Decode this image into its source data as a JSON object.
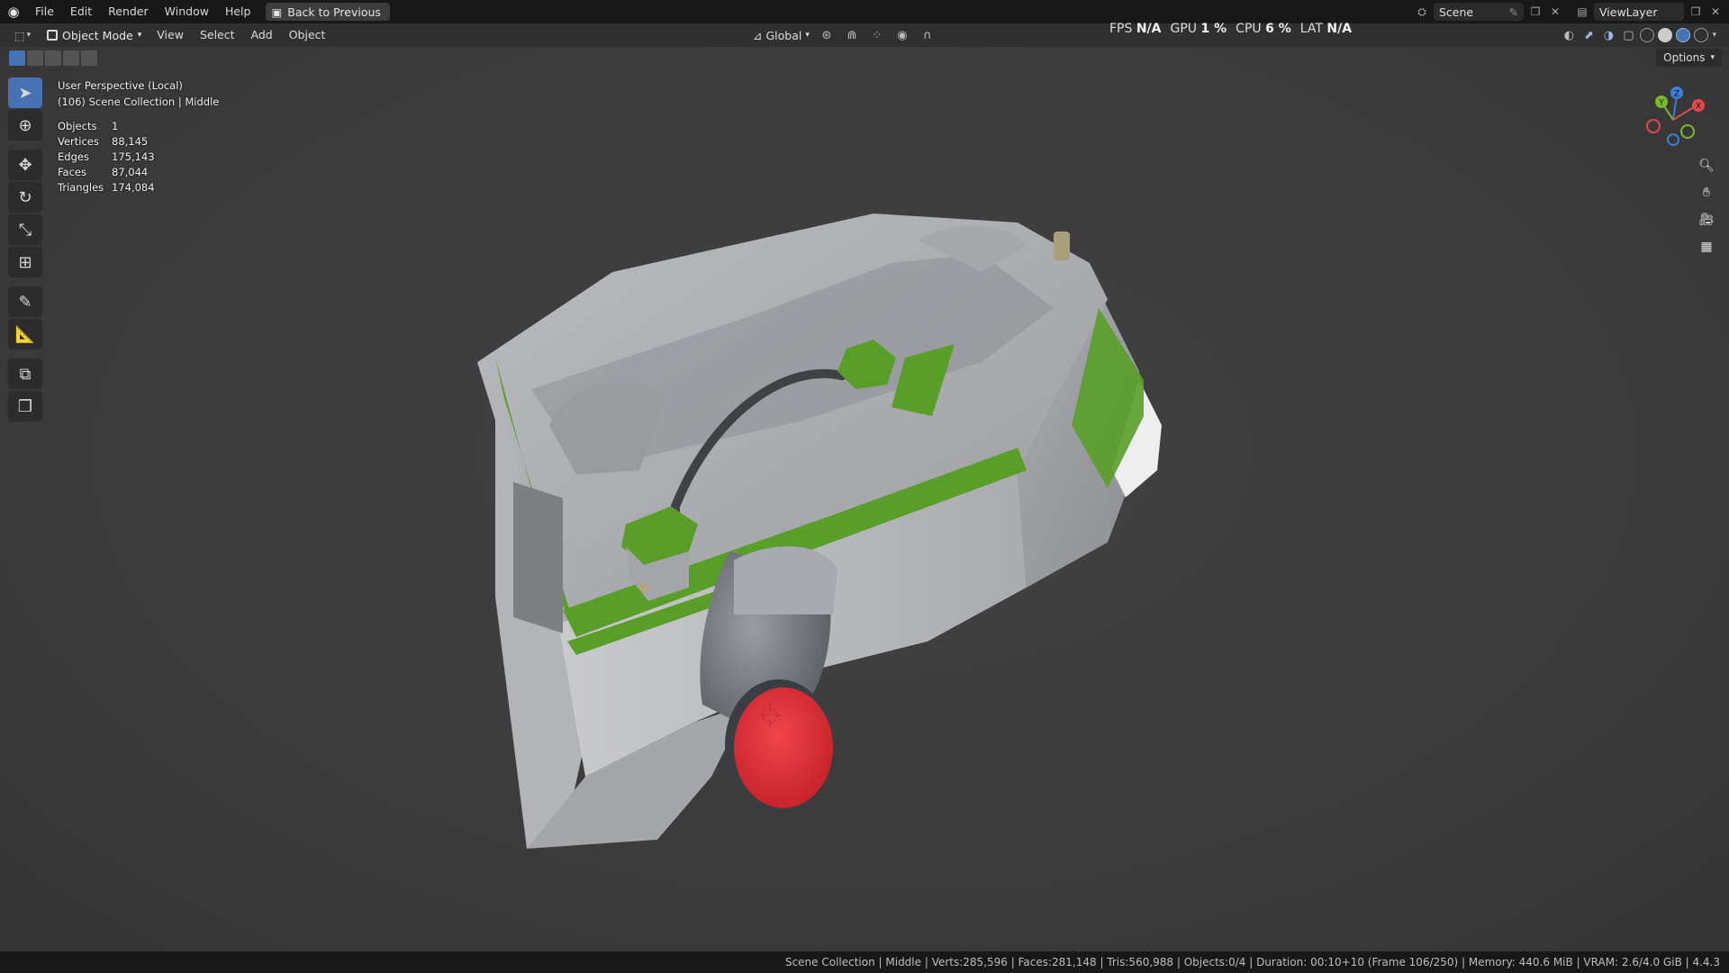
{
  "topbar": {
    "menus": [
      "File",
      "Edit",
      "Render",
      "Window",
      "Help"
    ],
    "back_label": "Back to Previous",
    "scene": "Scene",
    "view_layer": "ViewLayer"
  },
  "header": {
    "mode": "Object Mode",
    "menus": [
      "View",
      "Select",
      "Add",
      "Object"
    ],
    "orientation": "Global"
  },
  "perf": {
    "fps_label": "FPS",
    "fps_value": "N/A",
    "gpu_label": "GPU",
    "gpu_value": "1 %",
    "cpu_label": "CPU",
    "cpu_value": "6 %",
    "lat_label": "LAT",
    "lat_value": "N/A"
  },
  "viewport": {
    "options": "Options",
    "perspective": "User Perspective (Local)",
    "collection": "(106) Scene Collection | Middle",
    "stats": [
      {
        "label": "Objects",
        "value": "1"
      },
      {
        "label": "Vertices",
        "value": "88,145"
      },
      {
        "label": "Edges",
        "value": "175,143"
      },
      {
        "label": "Faces",
        "value": "87,044"
      },
      {
        "label": "Triangles",
        "value": "174,084"
      }
    ]
  },
  "gizmo": {
    "x": "X",
    "y": "Y",
    "z": "Z"
  },
  "status": "Scene Collection | Middle | Verts:285,596 | Faces:281,148 | Tris:560,988 | Objects:0/4 | Duration: 00:10+10 (Frame 106/250) | Memory: 440.6 MiB | VRAM: 2.6/4.0 GiB | 4.4.3",
  "colors": {
    "accent": "#4772b3",
    "model_green": "#5a9e2a",
    "model_red": "#e8323a"
  }
}
